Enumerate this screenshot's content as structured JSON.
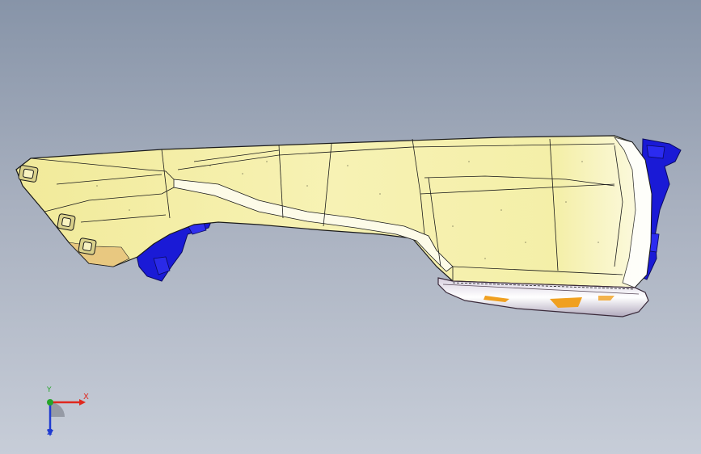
{
  "viewport": {
    "background_top": "#8794a8",
    "background_bottom": "#c7cdd8"
  },
  "model": {
    "body_color": "#f3efa6",
    "bracket_color": "#1a1ad6",
    "lens_color": "#f0a020",
    "edge_color": "#1a1a1a"
  },
  "triad": {
    "x_label": "X",
    "y_label": "Y",
    "z_label": "Z",
    "x_color": "#e0281e",
    "y_color": "#25a52a",
    "z_color": "#1f3bd1"
  }
}
